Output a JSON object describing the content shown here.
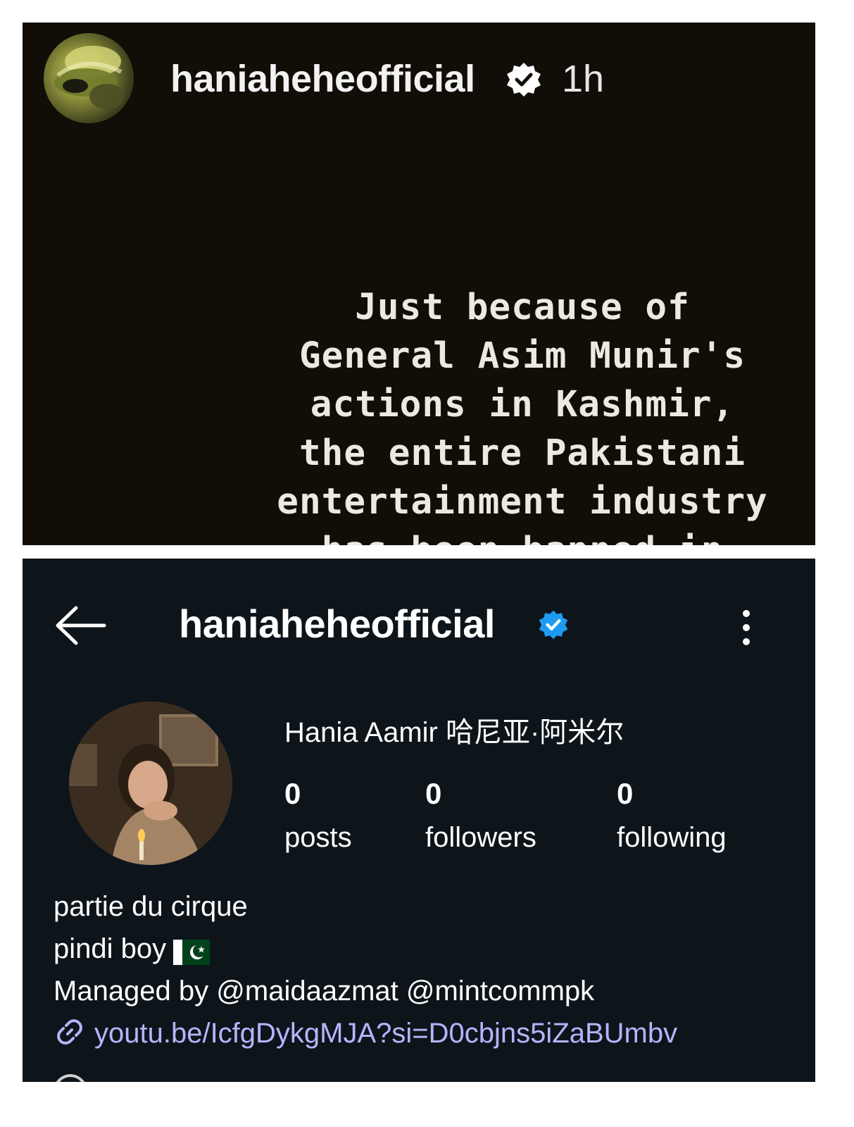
{
  "story": {
    "username": "haniaheheofficial",
    "time_ago": "1h",
    "verified_icon": "verified-badge-icon",
    "text": "Just because of\nGeneral Asim Munir's\nactions in Kashmir,\nthe entire Pakistani\nentertainment industry\nhas been banned in"
  },
  "profile": {
    "username": "haniaheheofficial",
    "verified_icon": "verified-badge-icon",
    "display_name": "Hania Aamir 哈尼亚·阿米尔",
    "stats": {
      "posts": {
        "count": "0",
        "label": "posts"
      },
      "followers": {
        "count": "0",
        "label": "followers"
      },
      "following": {
        "count": "0",
        "label": "following"
      }
    },
    "bio": {
      "line1": "partie du cirque",
      "line2": "pindi boy",
      "line3": "Managed by @maidaazmat @mintcommpk",
      "link": "youtu.be/IcfgDykgMJA?si=D0cbjns5iZaBUmbv"
    }
  },
  "colors": {
    "story_bg": "#120d06",
    "profile_bg": "#0d151b",
    "verified_blue": "#1d9bf0",
    "link": "#b7b4ff"
  }
}
